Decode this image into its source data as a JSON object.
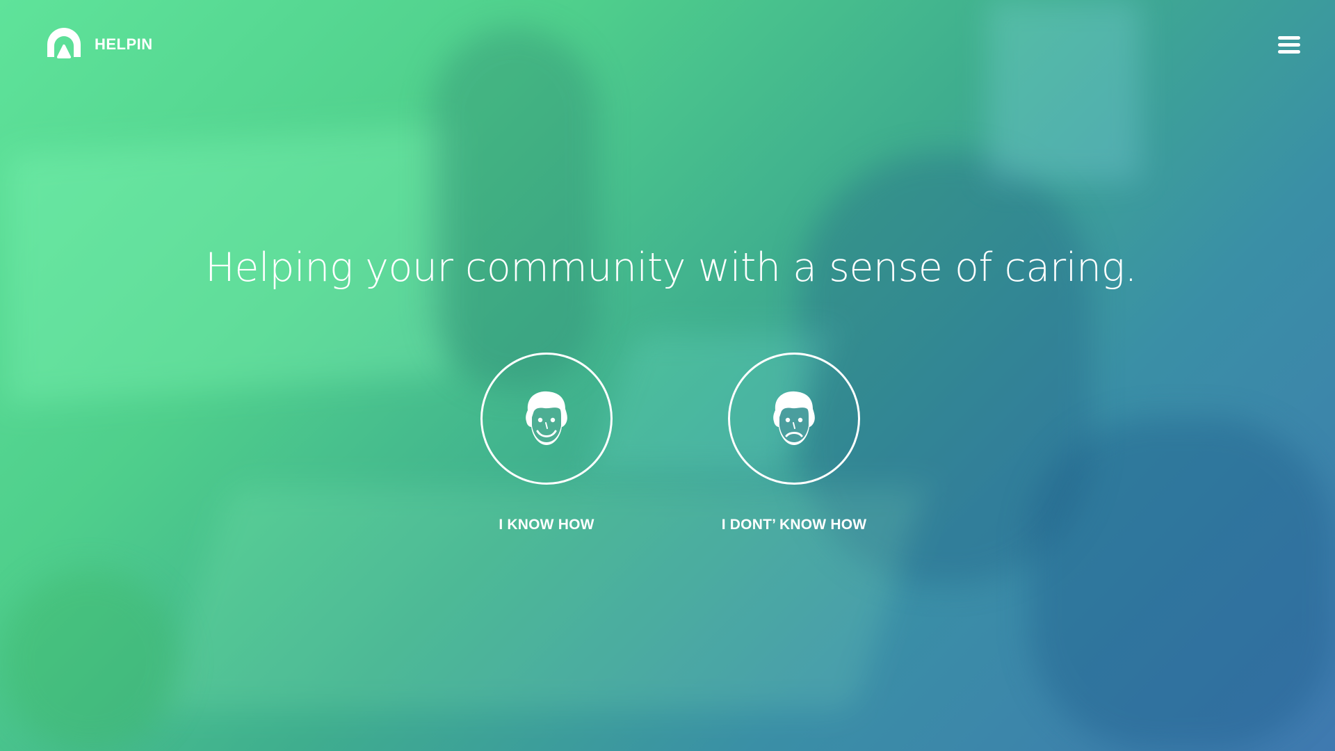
{
  "brand": {
    "name": "HELPIN",
    "logo_icon": "arch-logo-icon"
  },
  "header": {
    "menu_icon": "hamburger-menu-icon"
  },
  "hero": {
    "headline": "Helping your community with a sense of caring."
  },
  "choices": [
    {
      "label": "I KNOW HOW",
      "icon": "smiling-face-icon"
    },
    {
      "label": "I DONT’ KNOW HOW",
      "icon": "frowning-face-icon"
    }
  ],
  "colors": {
    "gradient_start": "#5fe39a",
    "gradient_end": "#3f79b0",
    "foreground": "#ffffff"
  }
}
